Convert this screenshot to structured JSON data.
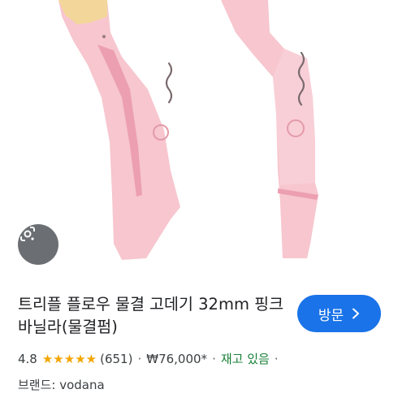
{
  "hero": {
    "lens_icon": "google-lens-icon",
    "colors": {
      "product": "#f7c6cf",
      "product_shade": "#ec9fb0",
      "plate": "#f3d79a"
    }
  },
  "product": {
    "title": "트리플 플로우 물결 고데기 32mm 핑크바닐라(물결펌)",
    "visit_label": "방문",
    "visit_icon": "chevron-right-icon",
    "rating": "4.8",
    "stars": "★★★★★",
    "review_count": "(651)",
    "price": "₩76,000*",
    "stock": "재고 있음",
    "brand": "브랜드: vodana",
    "accent_color": "#1a73e8",
    "star_color": "#f2a600",
    "stock_color": "#188038"
  }
}
